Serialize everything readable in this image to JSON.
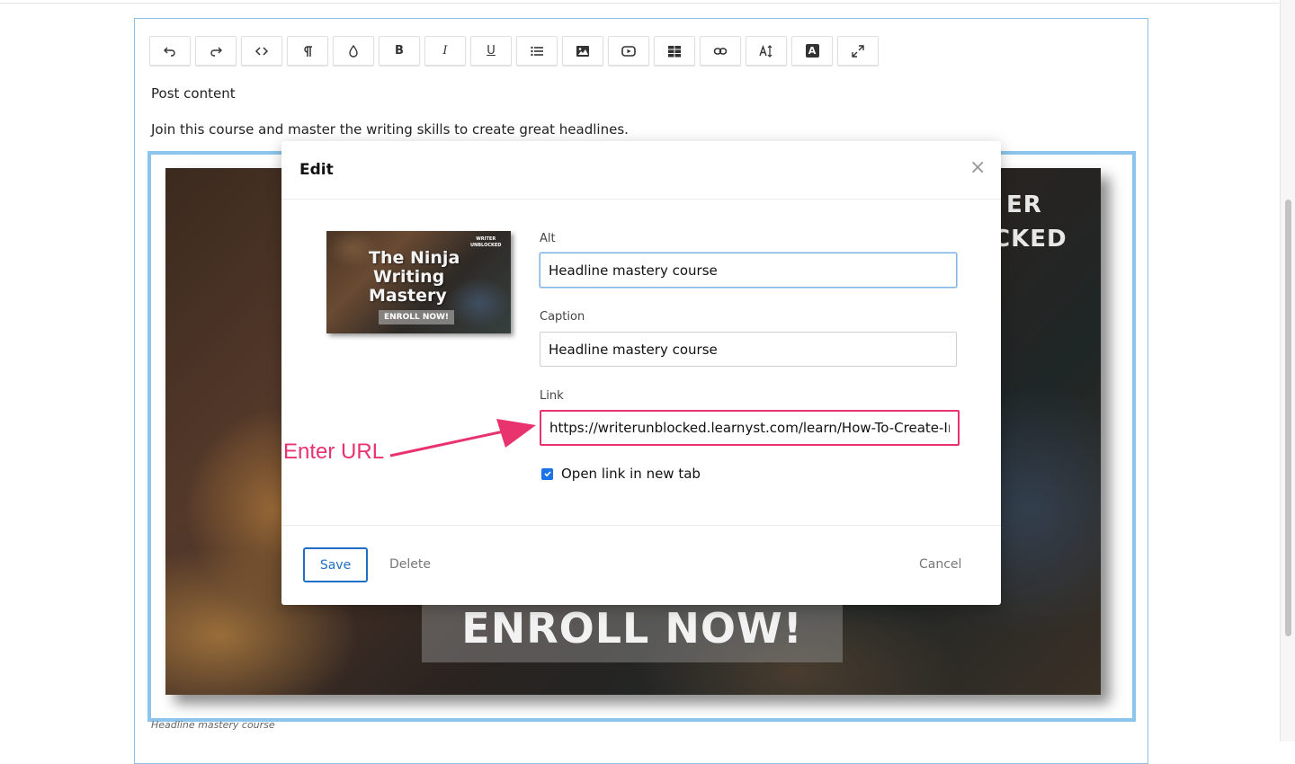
{
  "toolbar": {
    "buttons": [
      {
        "name": "undo",
        "icon": "undo-icon"
      },
      {
        "name": "redo",
        "icon": "redo-icon"
      },
      {
        "name": "code-view",
        "icon": "code-icon"
      },
      {
        "name": "paragraph",
        "icon": "paragraph-icon"
      },
      {
        "name": "color",
        "icon": "droplet-icon"
      },
      {
        "name": "bold",
        "label": "B"
      },
      {
        "name": "italic",
        "label": "I"
      },
      {
        "name": "underline",
        "label": "U"
      },
      {
        "name": "list",
        "icon": "list-icon"
      },
      {
        "name": "image",
        "icon": "image-icon"
      },
      {
        "name": "video",
        "icon": "video-icon"
      },
      {
        "name": "table",
        "icon": "table-icon"
      },
      {
        "name": "link",
        "icon": "link-icon"
      },
      {
        "name": "font-size",
        "icon": "font-size-icon"
      },
      {
        "name": "text-style",
        "label": "A"
      },
      {
        "name": "fullscreen",
        "icon": "expand-icon"
      }
    ]
  },
  "editor": {
    "label": "Post content",
    "paragraph": "Join this course and master the writing skills to create great headlines.",
    "image_text_line1": "ER",
    "image_text_line2": "CKED",
    "image_enroll": "ENROLL NOW!",
    "caption": "Headline mastery course"
  },
  "modal": {
    "title": "Edit",
    "close": "×",
    "thumbnail": {
      "brand_line1": "WRITER",
      "brand_line2": "UNBLOCKED",
      "line1": "The Ninja",
      "line2": "Writing",
      "line3": "Mastery",
      "button": "ENROLL NOW!"
    },
    "alt_label": "Alt",
    "alt_value": "Headline mastery course",
    "caption_label": "Caption",
    "caption_value": "Headline mastery course",
    "link_label": "Link",
    "link_value": "https://writerunblocked.learnyst.com/learn/How-To-Create-Ir",
    "open_new_tab_label": "Open link in new tab",
    "open_new_tab_checked": true,
    "save_label": "Save",
    "delete_label": "Delete",
    "cancel_label": "Cancel"
  },
  "annotation": {
    "text": "Enter URL",
    "color": "#e8336f"
  },
  "colors": {
    "accent": "#1f6fc5",
    "frame": "#8cc4ec",
    "highlight": "#e8336f"
  }
}
